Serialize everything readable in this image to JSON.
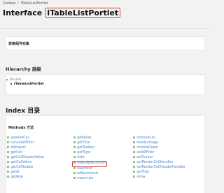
{
  "breadcrumb": {
    "root": "Globals",
    "parent": "ITableListPortlet"
  },
  "title": {
    "prefix": "Interface",
    "name": "ITableListPortlet"
  },
  "description": {
    "label": "表格组件对象"
  },
  "hierarchy": {
    "heading": "Hierarchy 层级",
    "parent": "IPortlet",
    "current": "ITableListPortlet"
  },
  "index": {
    "heading": "Index 目录"
  },
  "methods": {
    "heading": "Methods 方法",
    "columns": [
      [
        "appendCss",
        "cancelAllFilter",
        "doExport",
        "getCell",
        "getCellDisplayValue",
        "getCellValue",
        "getColHeader",
        "getId",
        "getRow"
      ],
      [
        "getRows",
        "getTitle",
        "getToolbar",
        "getType",
        "hide",
        "hideTableColumn",
        "isAllFilter",
        "isMaximized",
        "maximize"
      ],
      [
        "removeCss",
        "resetLinkage",
        "restoreDown",
        "setAllFilter",
        "setCursor",
        "setRenderCellHandler",
        "setRenderCellHeaderHandler",
        "setTitle",
        "show"
      ]
    ],
    "highlighted": "hideTableColumn"
  },
  "colors": {
    "link": "#4a86c8",
    "highlight": "#d8392b",
    "method_icon": "#6aa55b"
  }
}
